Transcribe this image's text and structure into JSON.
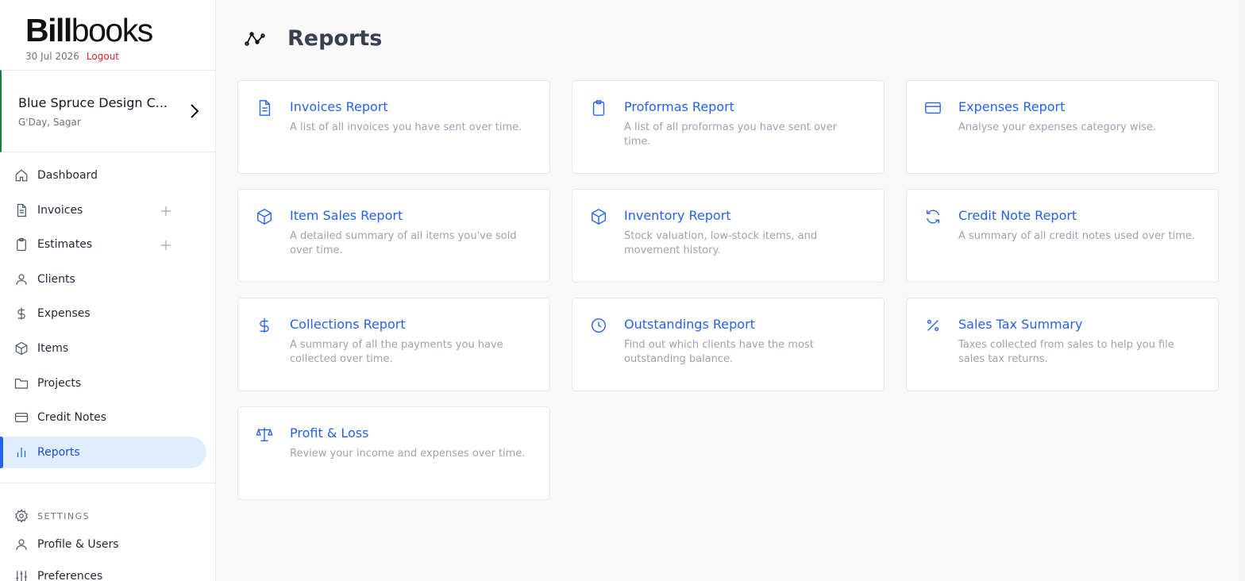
{
  "brand": {
    "logo_bold": "Bill",
    "logo_light": "books",
    "date": "30 Jul 2026",
    "logout": "Logout"
  },
  "company": {
    "name": "Blue Spruce Design C...",
    "greeting": "G'Day, Sagar"
  },
  "nav": [
    {
      "label": "Dashboard",
      "icon": "home-icon"
    },
    {
      "label": "Invoices",
      "icon": "document-icon"
    },
    {
      "label": "Estimates",
      "icon": "clipboard-icon"
    },
    {
      "label": "Clients",
      "icon": "user-icon"
    },
    {
      "label": "Expenses",
      "icon": "dollar-icon"
    },
    {
      "label": "Items",
      "icon": "box-icon"
    },
    {
      "label": "Projects",
      "icon": "folder-icon"
    },
    {
      "label": "Credit Notes",
      "icon": "credit-card-icon"
    },
    {
      "label": "Reports",
      "icon": "bar-chart-icon",
      "active": true
    }
  ],
  "settings": {
    "heading": "SETTINGS",
    "items": [
      {
        "label": "Profile & Users",
        "icon": "user-icon"
      },
      {
        "label": "Preferences",
        "icon": "sliders-icon"
      }
    ]
  },
  "page": {
    "title": "Reports",
    "icon": "line-chart-icon"
  },
  "reports": [
    {
      "title": "Invoices Report",
      "desc": "A list of all invoices you have sent over time.",
      "icon": "document-icon"
    },
    {
      "title": "Proformas Report",
      "desc": "A list of all proformas you have sent over time.",
      "icon": "clipboard-icon"
    },
    {
      "title": "Expenses Report",
      "desc": "Analyse your expenses category wise.",
      "icon": "credit-card-icon"
    },
    {
      "title": "Item Sales Report",
      "desc": "A detailed summary of all items you've sold over time.",
      "icon": "box-icon"
    },
    {
      "title": "Inventory Report",
      "desc": "Stock valuation, low-stock items, and movement history.",
      "icon": "box-icon"
    },
    {
      "title": "Credit Note Report",
      "desc": "A summary of all credit notes used over time.",
      "icon": "refresh-icon"
    },
    {
      "title": "Collections Report",
      "desc": "A summary of all the payments you have collected over time.",
      "icon": "dollar-icon"
    },
    {
      "title": "Outstandings Report",
      "desc": "Find out which clients have the most outstanding balance.",
      "icon": "clock-icon"
    },
    {
      "title": "Sales Tax Summary",
      "desc": "Taxes collected from sales to help you file sales tax returns.",
      "icon": "percent-icon"
    },
    {
      "title": "Profit & Loss",
      "desc": "Review your income and expenses over time.",
      "icon": "scale-icon"
    }
  ],
  "colors": {
    "accent": "#2563eb",
    "active_bg": "#e0edfd",
    "logout": "#dc2626",
    "company_border": "#15803d"
  }
}
